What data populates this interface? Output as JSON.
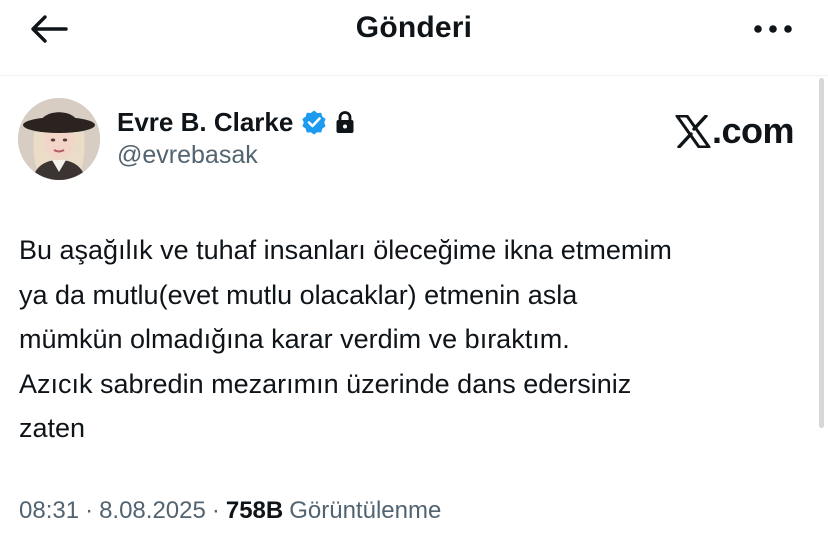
{
  "header": {
    "title": "Gönderi",
    "back_icon": "arrow-left-icon",
    "more_icon": "more-horizontal-icon"
  },
  "author": {
    "name": "Evre B. Clarke",
    "handle": "@evrebasak",
    "verified": true,
    "protected": true,
    "verified_color": "#1d9bf0"
  },
  "watermark": {
    "text": ".com"
  },
  "tweet": {
    "lines": [
      "Bu aşağılık ve tuhaf insanları öleceğime ikna etmemim",
      "ya da mutlu(evet mutlu olacaklar) etmenin asla",
      "mümkün olmadığına karar verdim ve bıraktım.",
      "Azıcık sabredin mezarımın üzerinde dans edersiniz",
      "zaten"
    ]
  },
  "meta": {
    "time": "08:31",
    "separator": "·",
    "date": "8.08.2025",
    "views_count": "758B",
    "views_label": "Görüntülenme"
  }
}
